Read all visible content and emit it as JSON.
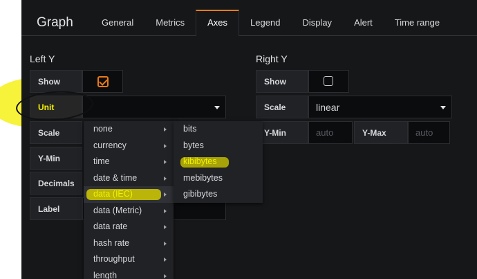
{
  "panel": {
    "title": "Graph",
    "tabs": [
      {
        "label": "General"
      },
      {
        "label": "Metrics"
      },
      {
        "label": "Axes"
      },
      {
        "label": "Legend"
      },
      {
        "label": "Display"
      },
      {
        "label": "Alert"
      },
      {
        "label": "Time range"
      }
    ],
    "active_tab": "Axes",
    "accent_color": "#eb7b18"
  },
  "left_y": {
    "title": "Left Y",
    "show_label": "Show",
    "show_checked": true,
    "unit_label": "Unit",
    "unit_value": "",
    "scale_label": "Scale",
    "ymin_label": "Y-Min",
    "decimals_label": "Decimals",
    "label_label": "Label"
  },
  "right_y": {
    "title": "Right Y",
    "show_label": "Show",
    "show_checked": false,
    "scale_label": "Scale",
    "scale_value": "linear",
    "ymin_label": "Y-Min",
    "ymin_placeholder": "auto",
    "ymax_label": "Y-Max",
    "ymax_placeholder": "auto"
  },
  "unit_menu": {
    "items": [
      {
        "label": "none"
      },
      {
        "label": "currency"
      },
      {
        "label": "time"
      },
      {
        "label": "date & time"
      },
      {
        "label": "data (IEC)"
      },
      {
        "label": "data (Metric)"
      },
      {
        "label": "data rate"
      },
      {
        "label": "hash rate"
      },
      {
        "label": "throughput"
      },
      {
        "label": "length"
      }
    ],
    "highlighted": "data (IEC)"
  },
  "submenu": {
    "items": [
      {
        "label": "bits"
      },
      {
        "label": "bytes"
      },
      {
        "label": "kibibytes"
      },
      {
        "label": "mebibytes"
      },
      {
        "label": "gibibytes"
      }
    ],
    "highlighted": "kibibytes"
  },
  "annotation_color": "#f7f23a"
}
